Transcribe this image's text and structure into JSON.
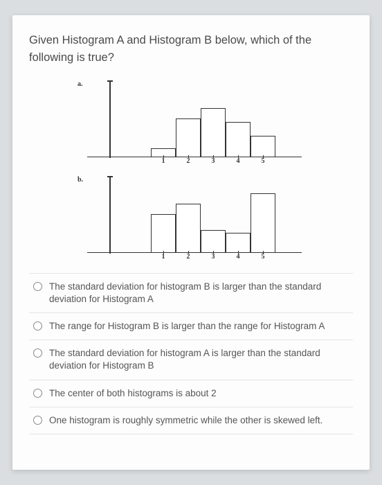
{
  "question": "Given Histogram A and Histogram B below, which of the following is true?",
  "chart_data": [
    {
      "type": "bar",
      "label": "a.",
      "categories": [
        "1",
        "2",
        "3",
        "4",
        "5"
      ],
      "values": [
        12,
        55,
        70,
        50,
        30
      ],
      "ylim": [
        0,
        100
      ]
    },
    {
      "type": "bar",
      "label": "b.",
      "categories": [
        "1",
        "2",
        "3",
        "4",
        "5"
      ],
      "values": [
        55,
        70,
        32,
        28,
        85
      ],
      "ylim": [
        0,
        100
      ]
    }
  ],
  "options": [
    "The standard deviation for histogram B is larger than the standard deviation for Histogram A",
    "The range for Histogram B is larger than the range for Histogram A",
    "The standard deviation for histogram A is larger than the standard deviation for Histogram B",
    "The center of both histograms is about 2",
    "One histogram is roughly symmetric while the other is skewed left."
  ]
}
